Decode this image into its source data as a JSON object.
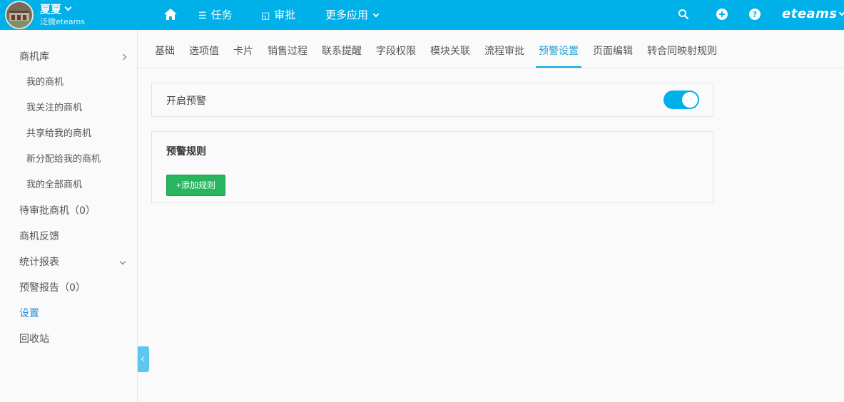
{
  "user": {
    "name": "夏夏",
    "org": "泛微eteams"
  },
  "nav": {
    "tasks_label": "任务",
    "approval_label": "审批",
    "more_label": "更多应用"
  },
  "brand": "eteams",
  "sidebar": {
    "items": [
      {
        "label": "商机库"
      },
      {
        "label": "我的商机"
      },
      {
        "label": "我关注的商机"
      },
      {
        "label": "共享给我的商机"
      },
      {
        "label": "新分配给我的商机"
      },
      {
        "label": "我的全部商机"
      },
      {
        "label": "待审批商机（0）"
      },
      {
        "label": "商机反馈"
      },
      {
        "label": "统计报表"
      },
      {
        "label": "预警报告（0）"
      },
      {
        "label": "设置"
      },
      {
        "label": "回收站"
      }
    ]
  },
  "tabs": [
    {
      "label": "基础"
    },
    {
      "label": "选项值"
    },
    {
      "label": "卡片"
    },
    {
      "label": "销售过程"
    },
    {
      "label": "联系提醒"
    },
    {
      "label": "字段权限"
    },
    {
      "label": "模块关联"
    },
    {
      "label": "流程审批"
    },
    {
      "label": "预警设置"
    },
    {
      "label": "页面编辑"
    },
    {
      "label": "转合同映射规则"
    }
  ],
  "warning": {
    "enable_label": "开启预警",
    "enabled": true,
    "rules_title": "预警规则",
    "add_rule_label": "+添加规则"
  },
  "colors": {
    "accent": "#00b0e8",
    "add_button": "#27b55f"
  }
}
